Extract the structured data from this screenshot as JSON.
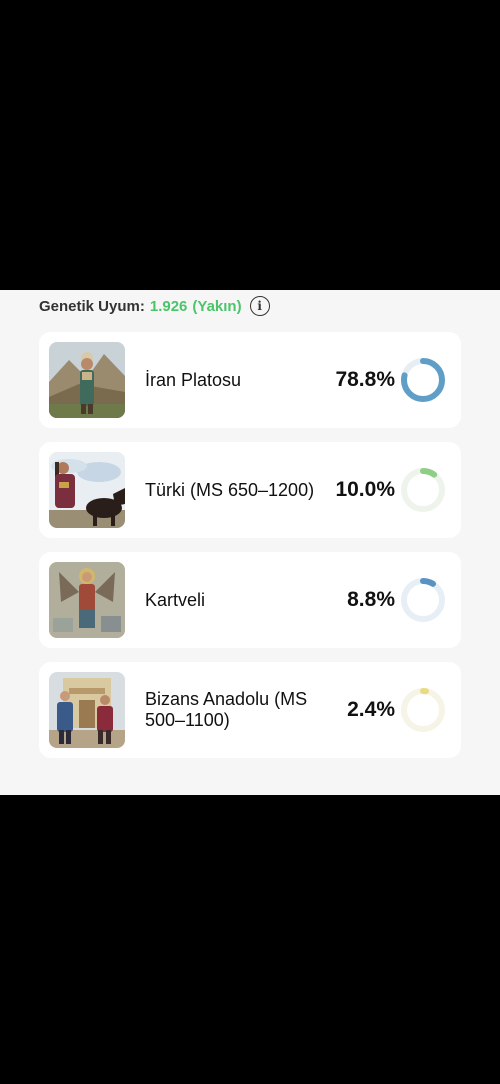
{
  "header": {
    "label": "Genetik Uyum:",
    "score": "1.926",
    "verdict": "(Yakın)",
    "score_color": "#4cc46a",
    "info_icon": "info-circle-icon"
  },
  "populations": [
    {
      "name": "İran Platosu",
      "percent_label": "78.8%",
      "percent": 78.8,
      "color": "#5f9ec6",
      "track": "#e6eef4"
    },
    {
      "name": "Türki (MS 650–1200)",
      "percent_label": "10.0%",
      "percent": 10.0,
      "color": "#8fce86",
      "track": "#eef4ec"
    },
    {
      "name": "Kartveli",
      "percent_label": "8.8%",
      "percent": 8.8,
      "color": "#5a93c2",
      "track": "#e6eef6"
    },
    {
      "name": "Bizans Anadolu (MS 500–1100)",
      "percent_label": "2.4%",
      "percent": 2.4,
      "color": "#e7dc84",
      "track": "#f6f4e6"
    }
  ]
}
